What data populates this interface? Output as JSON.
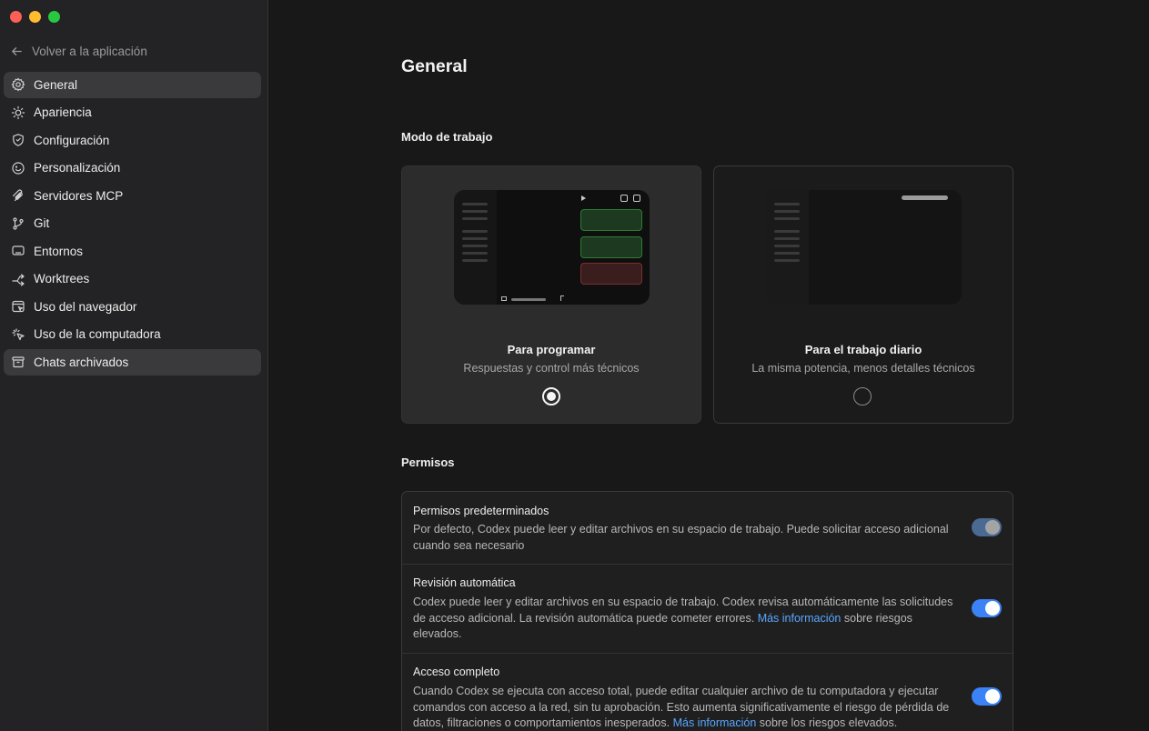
{
  "sidebar": {
    "back_label": "Volver a la aplicación",
    "items": [
      {
        "label": "General",
        "icon": "gear-icon"
      },
      {
        "label": "Apariencia",
        "icon": "sun-icon"
      },
      {
        "label": "Configuración",
        "icon": "shield-icon"
      },
      {
        "label": "Personalización",
        "icon": "smile-icon"
      },
      {
        "label": "Servidores MCP",
        "icon": "plug-icon"
      },
      {
        "label": "Git",
        "icon": "git-branch-icon"
      },
      {
        "label": "Entornos",
        "icon": "monitor-icon"
      },
      {
        "label": "Worktrees",
        "icon": "worktree-icon"
      },
      {
        "label": "Uso del navegador",
        "icon": "browser-icon"
      },
      {
        "label": "Uso de la computadora",
        "icon": "cursor-click-icon"
      },
      {
        "label": "Chats archivados",
        "icon": "archive-icon"
      }
    ],
    "active_index": 0
  },
  "main": {
    "title": "General",
    "work_mode": {
      "heading": "Modo de trabajo",
      "options": [
        {
          "name": "Para programar",
          "description": "Respuestas y control más técnicos",
          "selected": true
        },
        {
          "name": "Para el trabajo diario",
          "description": "La misma potencia, menos detalles técnicos",
          "selected": false
        }
      ]
    },
    "permissions": {
      "heading": "Permisos",
      "rows": [
        {
          "title": "Permisos predeterminados",
          "description": "Por defecto, Codex puede leer y editar archivos en su espacio de trabajo. Puede solicitar acceso adicional cuando sea necesario",
          "enabled": true
        },
        {
          "title": "Revisión automática",
          "description_before": "Codex puede leer y editar archivos en su espacio de trabajo. Codex revisa automáticamente las solicitudes de acceso adicional. La revisión automática puede cometer errores. ",
          "link": "Más información",
          "description_after": " sobre riesgos elevados.",
          "enabled": true
        },
        {
          "title": "Acceso completo",
          "description_before": "Cuando Codex se ejecuta con acceso total, puede editar cualquier archivo de tu computadora y ejecutar comandos con acceso a la red, sin tu aprobación. Esto aumenta significativamente el riesgo de pérdida de datos, filtraciones o comportamientos inesperados. ",
          "link": "Más información",
          "description_after": " sobre los riesgos elevados.",
          "enabled": true
        }
      ]
    }
  },
  "colors": {
    "accent": "#3b82f6",
    "link": "#5aa7ff",
    "sidebar_bg": "#232325",
    "main_bg": "#181818"
  }
}
